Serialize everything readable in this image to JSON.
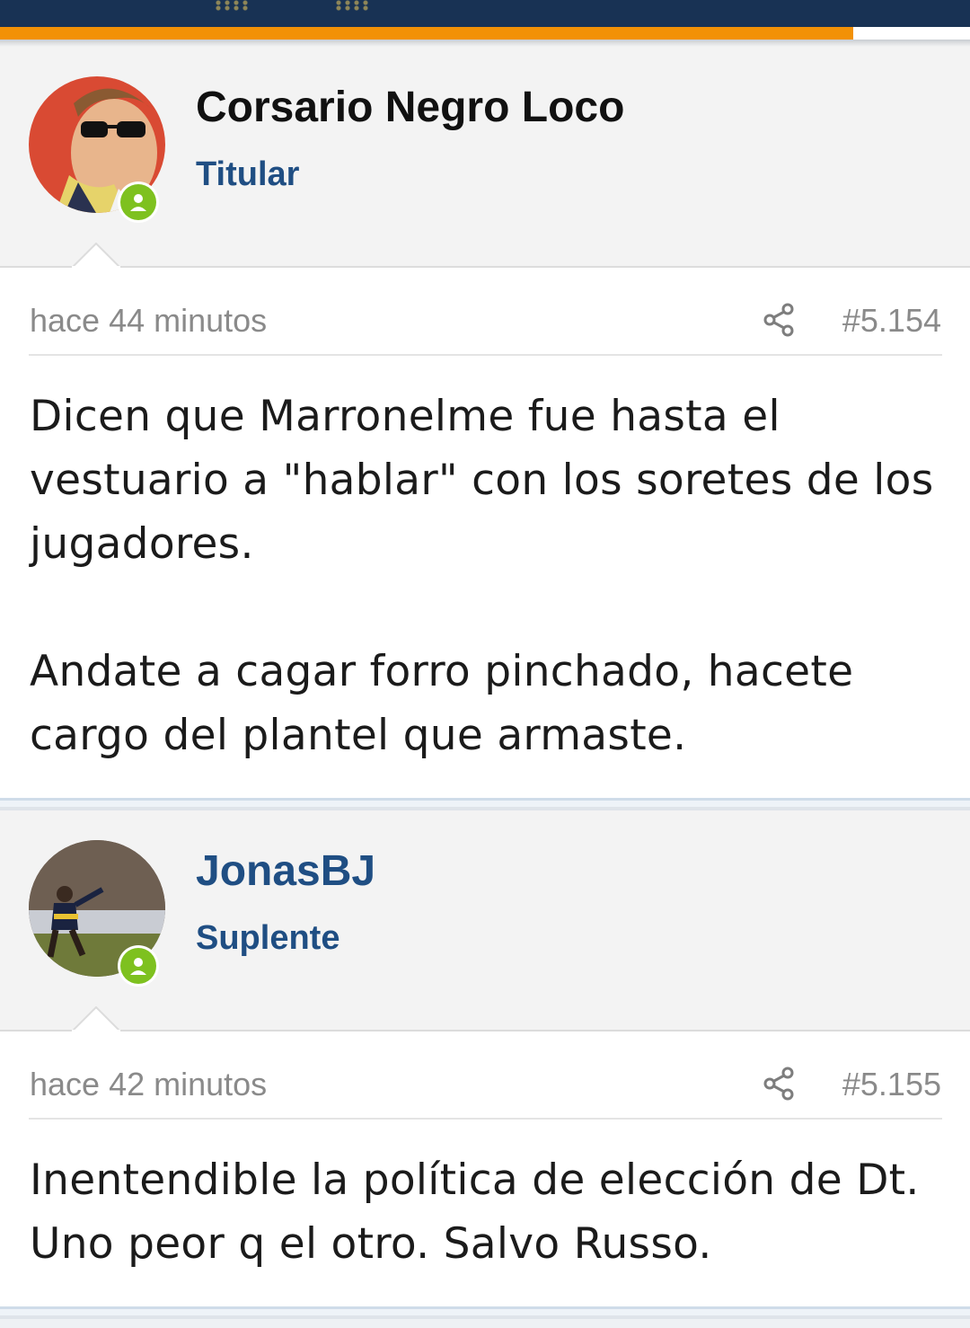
{
  "header": {
    "brand_color": "#183254",
    "accent_color": "#f29106",
    "reading_progress_percent": 88
  },
  "posts": [
    {
      "author": "Corsario Negro Loco",
      "rank": "Titular",
      "online": true,
      "avatar_icon": "user-avatar-sunglasses",
      "time": "hace 44 minutos",
      "share_icon": "share-icon",
      "number": "#5.154",
      "paragraphs": [
        "Dicen que Marronelme fue hasta el vestuario a \"hablar\" con los soretes de los jugadores.",
        "Andate a cagar forro pinchado, hacete cargo del plantel que armaste."
      ]
    },
    {
      "author": "JonasBJ",
      "rank": "Suplente",
      "online": true,
      "avatar_icon": "user-avatar-footballer",
      "time": "hace 42 minutos",
      "share_icon": "share-icon",
      "number": "#5.155",
      "paragraphs": [
        "Inentendible la política de elección de Dt. Uno peor q el otro. Salvo Russo."
      ]
    }
  ]
}
